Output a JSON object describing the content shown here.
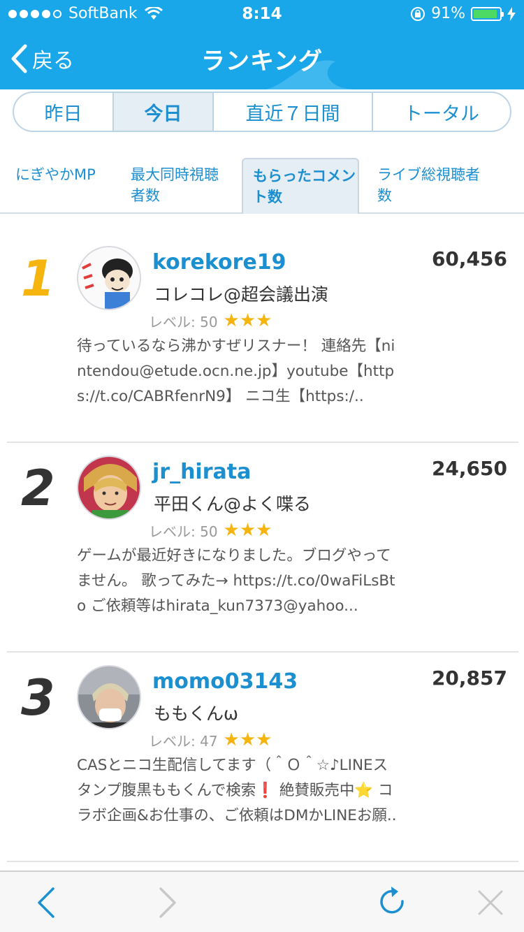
{
  "status_bar": {
    "carrier": "SoftBank",
    "time": "8:14",
    "battery_percent": "91%",
    "battery_level": 0.91,
    "signal_bars_filled": 4,
    "signal_bars_total": 5
  },
  "nav": {
    "back_label": "戻る",
    "title": "ランキング"
  },
  "period_tabs": [
    {
      "label": "昨日",
      "active": false
    },
    {
      "label": "今日",
      "active": true
    },
    {
      "label": "直近７日間",
      "active": false
    },
    {
      "label": "トータル",
      "active": false
    }
  ],
  "category_tabs": [
    {
      "label": "にぎやかMP",
      "active": false
    },
    {
      "label": "最大同時視聴者数",
      "active": false
    },
    {
      "label": "もらったコメント数",
      "active": true
    },
    {
      "label": "ライブ総視聴者数",
      "active": false
    }
  ],
  "rankings": [
    {
      "rank": "1",
      "user_id": "korekore19",
      "display_name": "コレコレ@超会議出演",
      "level": "レベル: 50",
      "stars": "★★★",
      "description": "待っているなら沸かすぜリスナー！ 連絡先【nintendou@etude.ocn.ne.jp】youtube【https://t.co/CABRfenrN9】 ニコ生【https:/..",
      "count": "60,456"
    },
    {
      "rank": "2",
      "user_id": "jr_hirata",
      "display_name": "平田くん@よく喋る",
      "level": "レベル: 50",
      "stars": "★★★",
      "description": "ゲームが最近好きになりました。ブログやってません。 歌ってみた→ https://t.co/0waFiLsBto ご依頼等はhirata_kun7373@yahoo...",
      "count": "24,650"
    },
    {
      "rank": "3",
      "user_id": "momo03143",
      "display_name": "ももくんω",
      "level": "レベル: 47",
      "stars": "★★★",
      "description": "CASとニコ生配信してます（＾Ｏ＾☆♪LINEスタンプ腹黒ももくんで検索❗️ 絶賛販売中⭐️ コラボ企画&お仕事の、ご依頼はDMかLINEお願..",
      "count": "20,857"
    }
  ],
  "colors": {
    "header_bg": "#1aa7ea",
    "accent": "#1c8fd1",
    "gold": "#f6b40e",
    "battery": "#4cd964"
  },
  "toolbar": {
    "icons": [
      "back-arrow-icon",
      "forward-arrow-icon",
      "reload-icon",
      "close-icon"
    ]
  }
}
